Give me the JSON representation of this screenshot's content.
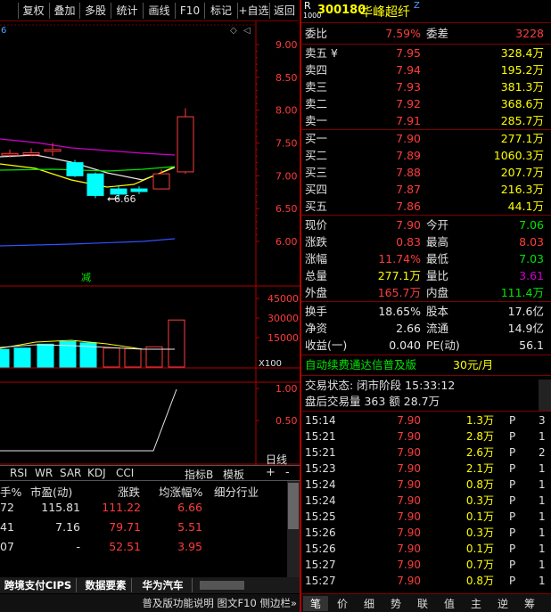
{
  "toolbar": {
    "items": [
      "复权",
      "叠加",
      "多股",
      "统计",
      "画线",
      "F10",
      "标记",
      "+自选",
      "返回"
    ]
  },
  "chart": {
    "price_ticks": [
      "9.00",
      "8.50",
      "8.00",
      "7.50",
      "7.00",
      "6.50",
      "6.00"
    ],
    "volume_ticks": [
      "45000",
      "30000",
      "15000"
    ],
    "volume_unit": "X100",
    "indicator_ticks": [
      "1.00",
      "0.50"
    ],
    "low_annotation": "6.66",
    "jian_label": "减",
    "dayline_label": "日线"
  },
  "indicator_tabs": [
    "RSI",
    "WR",
    "SAR",
    "KDJ",
    "CCI"
  ],
  "indicator_b": "指标B",
  "template": "模板",
  "sector_table": {
    "headers": [
      "手%",
      "市盈(动)",
      "涨跌",
      "均涨幅%",
      "细分行业"
    ],
    "rows": [
      [
        "72",
        "115.81",
        "111.22",
        "6.66",
        ""
      ],
      [
        "41",
        "7.16",
        "79.71",
        "5.51",
        ""
      ],
      [
        "07",
        "-",
        "52.51",
        "3.95",
        ""
      ]
    ]
  },
  "bottom_tabs": [
    "跨境支付CIPS",
    "数据要素",
    "华为汽车"
  ],
  "help_text": "普及版功能说明 图文F10 侧边栏»",
  "stock": {
    "r_mark": "R",
    "code": "300180",
    "name": "华峰超纤",
    "z_mark": "Z",
    "sub_mark": "1000"
  },
  "weibi": {
    "label1": "委比",
    "v1": "7.59%",
    "label2": "委差",
    "v2": "3228"
  },
  "asks": [
    {
      "label": "卖五 ¥",
      "price": "7.95",
      "vol": "328.4万"
    },
    {
      "label": "卖四",
      "price": "7.94",
      "vol": "195.2万"
    },
    {
      "label": "卖三",
      "price": "7.93",
      "vol": "381.3万"
    },
    {
      "label": "卖二",
      "price": "7.92",
      "vol": "368.6万"
    },
    {
      "label": "卖一",
      "price": "7.91",
      "vol": "285.7万"
    }
  ],
  "bids": [
    {
      "label": "买一",
      "price": "7.90",
      "vol": "277.1万"
    },
    {
      "label": "买二",
      "price": "7.89",
      "vol": "1060.3万"
    },
    {
      "label": "买三",
      "price": "7.88",
      "vol": "207.7万"
    },
    {
      "label": "买四",
      "price": "7.87",
      "vol": "216.3万"
    },
    {
      "label": "买五",
      "price": "7.86",
      "vol": "44.1万"
    }
  ],
  "quote": [
    {
      "l1": "现价",
      "v1": "7.90",
      "c1": "red",
      "l2": "今开",
      "v2": "7.06",
      "c2": "green"
    },
    {
      "l1": "涨跌",
      "v1": "0.83",
      "c1": "red",
      "l2": "最高",
      "v2": "8.03",
      "c2": "red"
    },
    {
      "l1": "涨幅",
      "v1": "11.74%",
      "c1": "red",
      "l2": "最低",
      "v2": "7.03",
      "c2": "green"
    },
    {
      "l1": "总量",
      "v1": "277.1万",
      "c1": "yellow",
      "l2": "量比",
      "v2": "3.61",
      "c2": "purple"
    },
    {
      "l1": "外盘",
      "v1": "165.7万",
      "c1": "red",
      "l2": "内盘",
      "v2": "111.4万",
      "c2": "green"
    }
  ],
  "fund": [
    {
      "l1": "换手",
      "v1": "18.65%",
      "l2": "股本",
      "v2": "17.6亿"
    },
    {
      "l1": "净资",
      "v1": "2.66",
      "l2": "流通",
      "v2": "14.9亿"
    },
    {
      "l1": "收益(一)",
      "v1": "0.040",
      "l2": "PE(动)",
      "v2": "56.1"
    }
  ],
  "ad": {
    "text": "自动续费通达信普及版",
    "price": "30元/月"
  },
  "status": {
    "line1": "交易状态: 闭市阶段 15:33:12",
    "line2": "盘后交易量 363 额 28.7万"
  },
  "ticks": [
    {
      "t": "15:14",
      "p": "7.90",
      "v": "1.3万",
      "f": "P",
      "n": "3"
    },
    {
      "t": "15:21",
      "p": "7.90",
      "v": "2.8万",
      "f": "P",
      "n": "1"
    },
    {
      "t": "15:21",
      "p": "7.90",
      "v": "2.6万",
      "f": "P",
      "n": "2"
    },
    {
      "t": "15:23",
      "p": "7.90",
      "v": "2.1万",
      "f": "P",
      "n": "1"
    },
    {
      "t": "15:24",
      "p": "7.90",
      "v": "0.8万",
      "f": "P",
      "n": "1"
    },
    {
      "t": "15:24",
      "p": "7.90",
      "v": "0.3万",
      "f": "P",
      "n": "1"
    },
    {
      "t": "15:25",
      "p": "7.90",
      "v": "0.1万",
      "f": "P",
      "n": "1"
    },
    {
      "t": "15:26",
      "p": "7.90",
      "v": "0.3万",
      "f": "P",
      "n": "1"
    },
    {
      "t": "15:26",
      "p": "7.90",
      "v": "0.1万",
      "f": "P",
      "n": "1"
    },
    {
      "t": "15:27",
      "p": "7.90",
      "v": "0.7万",
      "f": "P",
      "n": "1"
    },
    {
      "t": "15:27",
      "p": "7.90",
      "v": "0.8万",
      "f": "P",
      "n": "1"
    }
  ],
  "tabs": [
    "笔",
    "价",
    "细",
    "势",
    "联",
    "值",
    "主",
    "逆",
    "筹"
  ],
  "chart_data": {
    "type": "candlestick",
    "candles": [
      {
        "o": 7.34,
        "c": 7.34,
        "h": 7.4,
        "l": 7.28
      },
      {
        "o": 7.35,
        "c": 7.35,
        "h": 7.42,
        "l": 7.3
      },
      {
        "o": 7.4,
        "c": 7.4,
        "h": 7.5,
        "l": 7.3
      },
      {
        "o": 7.2,
        "c": 7.0,
        "h": 7.24,
        "l": 6.98
      },
      {
        "o": 7.03,
        "c": 6.7,
        "h": 7.05,
        "l": 6.66
      },
      {
        "o": 6.8,
        "c": 6.72,
        "h": 6.84,
        "l": 6.66
      },
      {
        "o": 6.8,
        "c": 6.76,
        "h": 6.84,
        "l": 6.72
      },
      {
        "o": 6.8,
        "c": 7.03,
        "h": 7.1,
        "l": 6.8
      },
      {
        "o": 7.06,
        "c": 7.9,
        "h": 8.03,
        "l": 7.03
      }
    ],
    "volumes": [
      7000,
      10000,
      12000,
      11000,
      7000,
      6500,
      8000,
      28500
    ],
    "volume_colors": [
      "cyan",
      "cyan",
      "cyan",
      "cyan",
      "red",
      "red",
      "red",
      "red"
    ],
    "ylim": [
      5.9,
      9.2
    ]
  }
}
